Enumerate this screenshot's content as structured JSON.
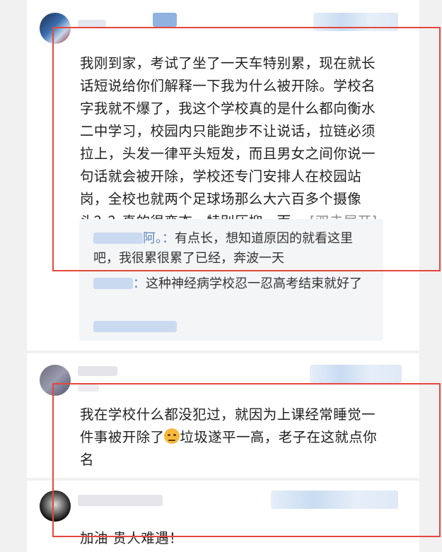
{
  "comments": [
    {
      "text": "我刚到家，考试了坐了一天车特别累，现在就长话短说给你们解释一下我为什么被开除。学校名字我就不爆了，我这个学校真的是什么都向衡水二中学习，校园内只能跑步不让说话，拉链必须拉上，头发一律平头短发，而且男女之间你说一句话就会被开除，学校还专门安排人在校园站岗，全校也就两个足球场那么大六百多个摄像头？？真的很变态，特别压抑，而",
      "expand_label": "... [双击展开]",
      "replies": [
        {
          "name": "阿。：",
          "text": "有点长，想知道原因的就看这里吧，我很累很累了已经，奔波一天"
        },
        {
          "name": "：",
          "text": "这种神经病学校忍一忍高考结束就好了"
        }
      ]
    },
    {
      "text_before_emoji": "我在学校什么都没犯过，就因为上课经常睡觉一件事被开除了",
      "text_after_emoji": "垃圾遂平一高，老子在这就点你名",
      "emoji": "upside-down-face"
    },
    {
      "text": "加油 贵人难遇！"
    }
  ],
  "colors": {
    "highlight_box": "#e5473c",
    "reply_name": "#5b84b8",
    "expand": "#8a8a8a"
  }
}
